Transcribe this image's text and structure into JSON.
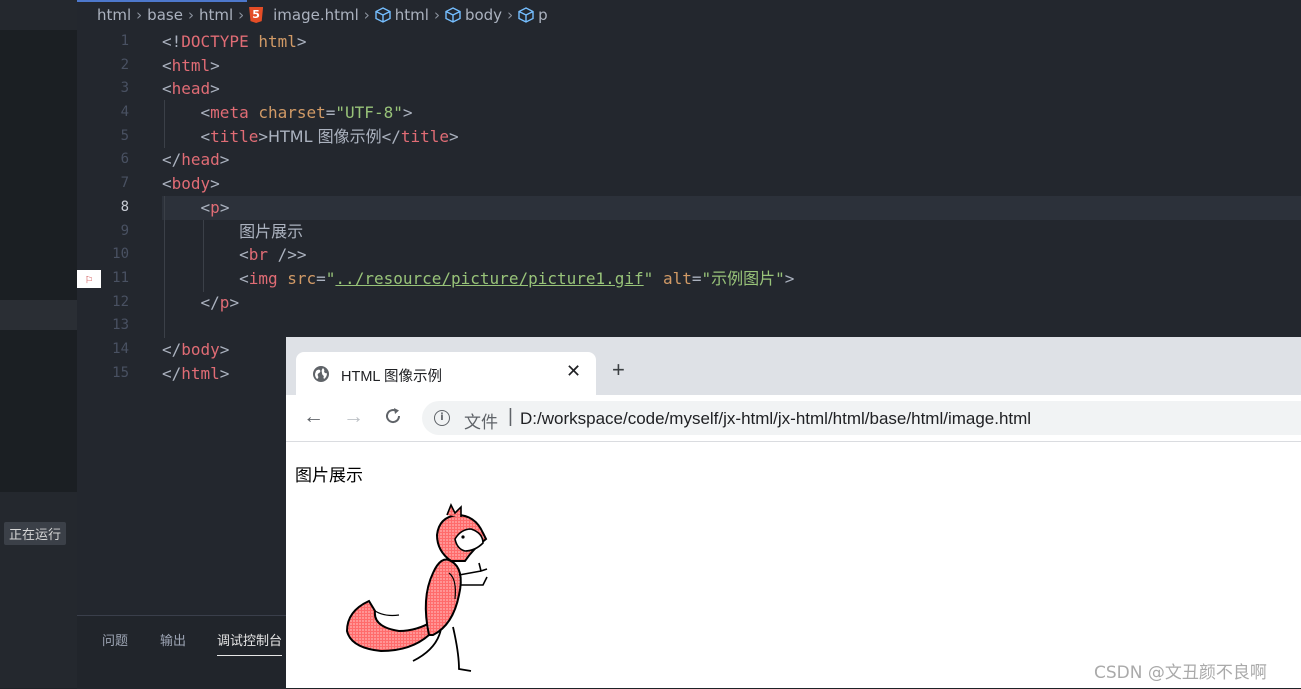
{
  "breadcrumb": [
    "html",
    "base",
    "html",
    "image.html",
    "html",
    "body",
    "p"
  ],
  "editor": {
    "active_line": 8,
    "line_numbers": [
      "1",
      "2",
      "3",
      "4",
      "5",
      "6",
      "7",
      "8",
      "9",
      "10",
      "11",
      "12",
      "13",
      "14",
      "15"
    ],
    "code": {
      "l1": {
        "open": "<!",
        "tag": "DOCTYPE",
        "rest": " html",
        "close": ">"
      },
      "l2": {
        "tag": "html"
      },
      "l3": {
        "tag": "head"
      },
      "l4": {
        "tag": "meta",
        "attr": " charset",
        "eq": "=",
        "val": "\"UTF-8\""
      },
      "l5": {
        "tag": "title",
        "text": "HTML 图像示例",
        "endtag": "title"
      },
      "l6": {
        "tag": "head"
      },
      "l7": {
        "tag": "body"
      },
      "l8": {
        "tag": "p"
      },
      "l9": {
        "text": "图片展示"
      },
      "l10": {
        "tag": "br",
        "tail": " />"
      },
      "l11": {
        "tag": "img",
        "attr1": " src",
        "q1": "\"",
        "link": "../resource/picture/picture1.gif",
        "q2": "\"",
        "attr2": " alt",
        "val2": "\"示例图片\""
      },
      "l12": {
        "tag": "p"
      },
      "l14": {
        "tag": "body"
      },
      "l15": {
        "tag": "html"
      }
    }
  },
  "sidebar": {
    "running_label": "正在运行"
  },
  "panel": {
    "tabs": [
      "问题",
      "输出",
      "调试控制台"
    ]
  },
  "browser": {
    "tab_title": "HTML 图像示例",
    "tab_close": "✕",
    "new_tab": "+",
    "file_label": "文件",
    "url_separator": "|",
    "url": "D:/workspace/code/myself/jx-html/jx-html/html/base/html/image.html",
    "page_text": "图片展示",
    "image_alt": "示例图片"
  },
  "watermark": "CSDN @文丑颜不良啊",
  "colors": {
    "tag": "#e06c75",
    "attribute": "#d19a66",
    "string": "#98c379",
    "editor_bg": "#23272e",
    "accent": "#4d78cc"
  }
}
